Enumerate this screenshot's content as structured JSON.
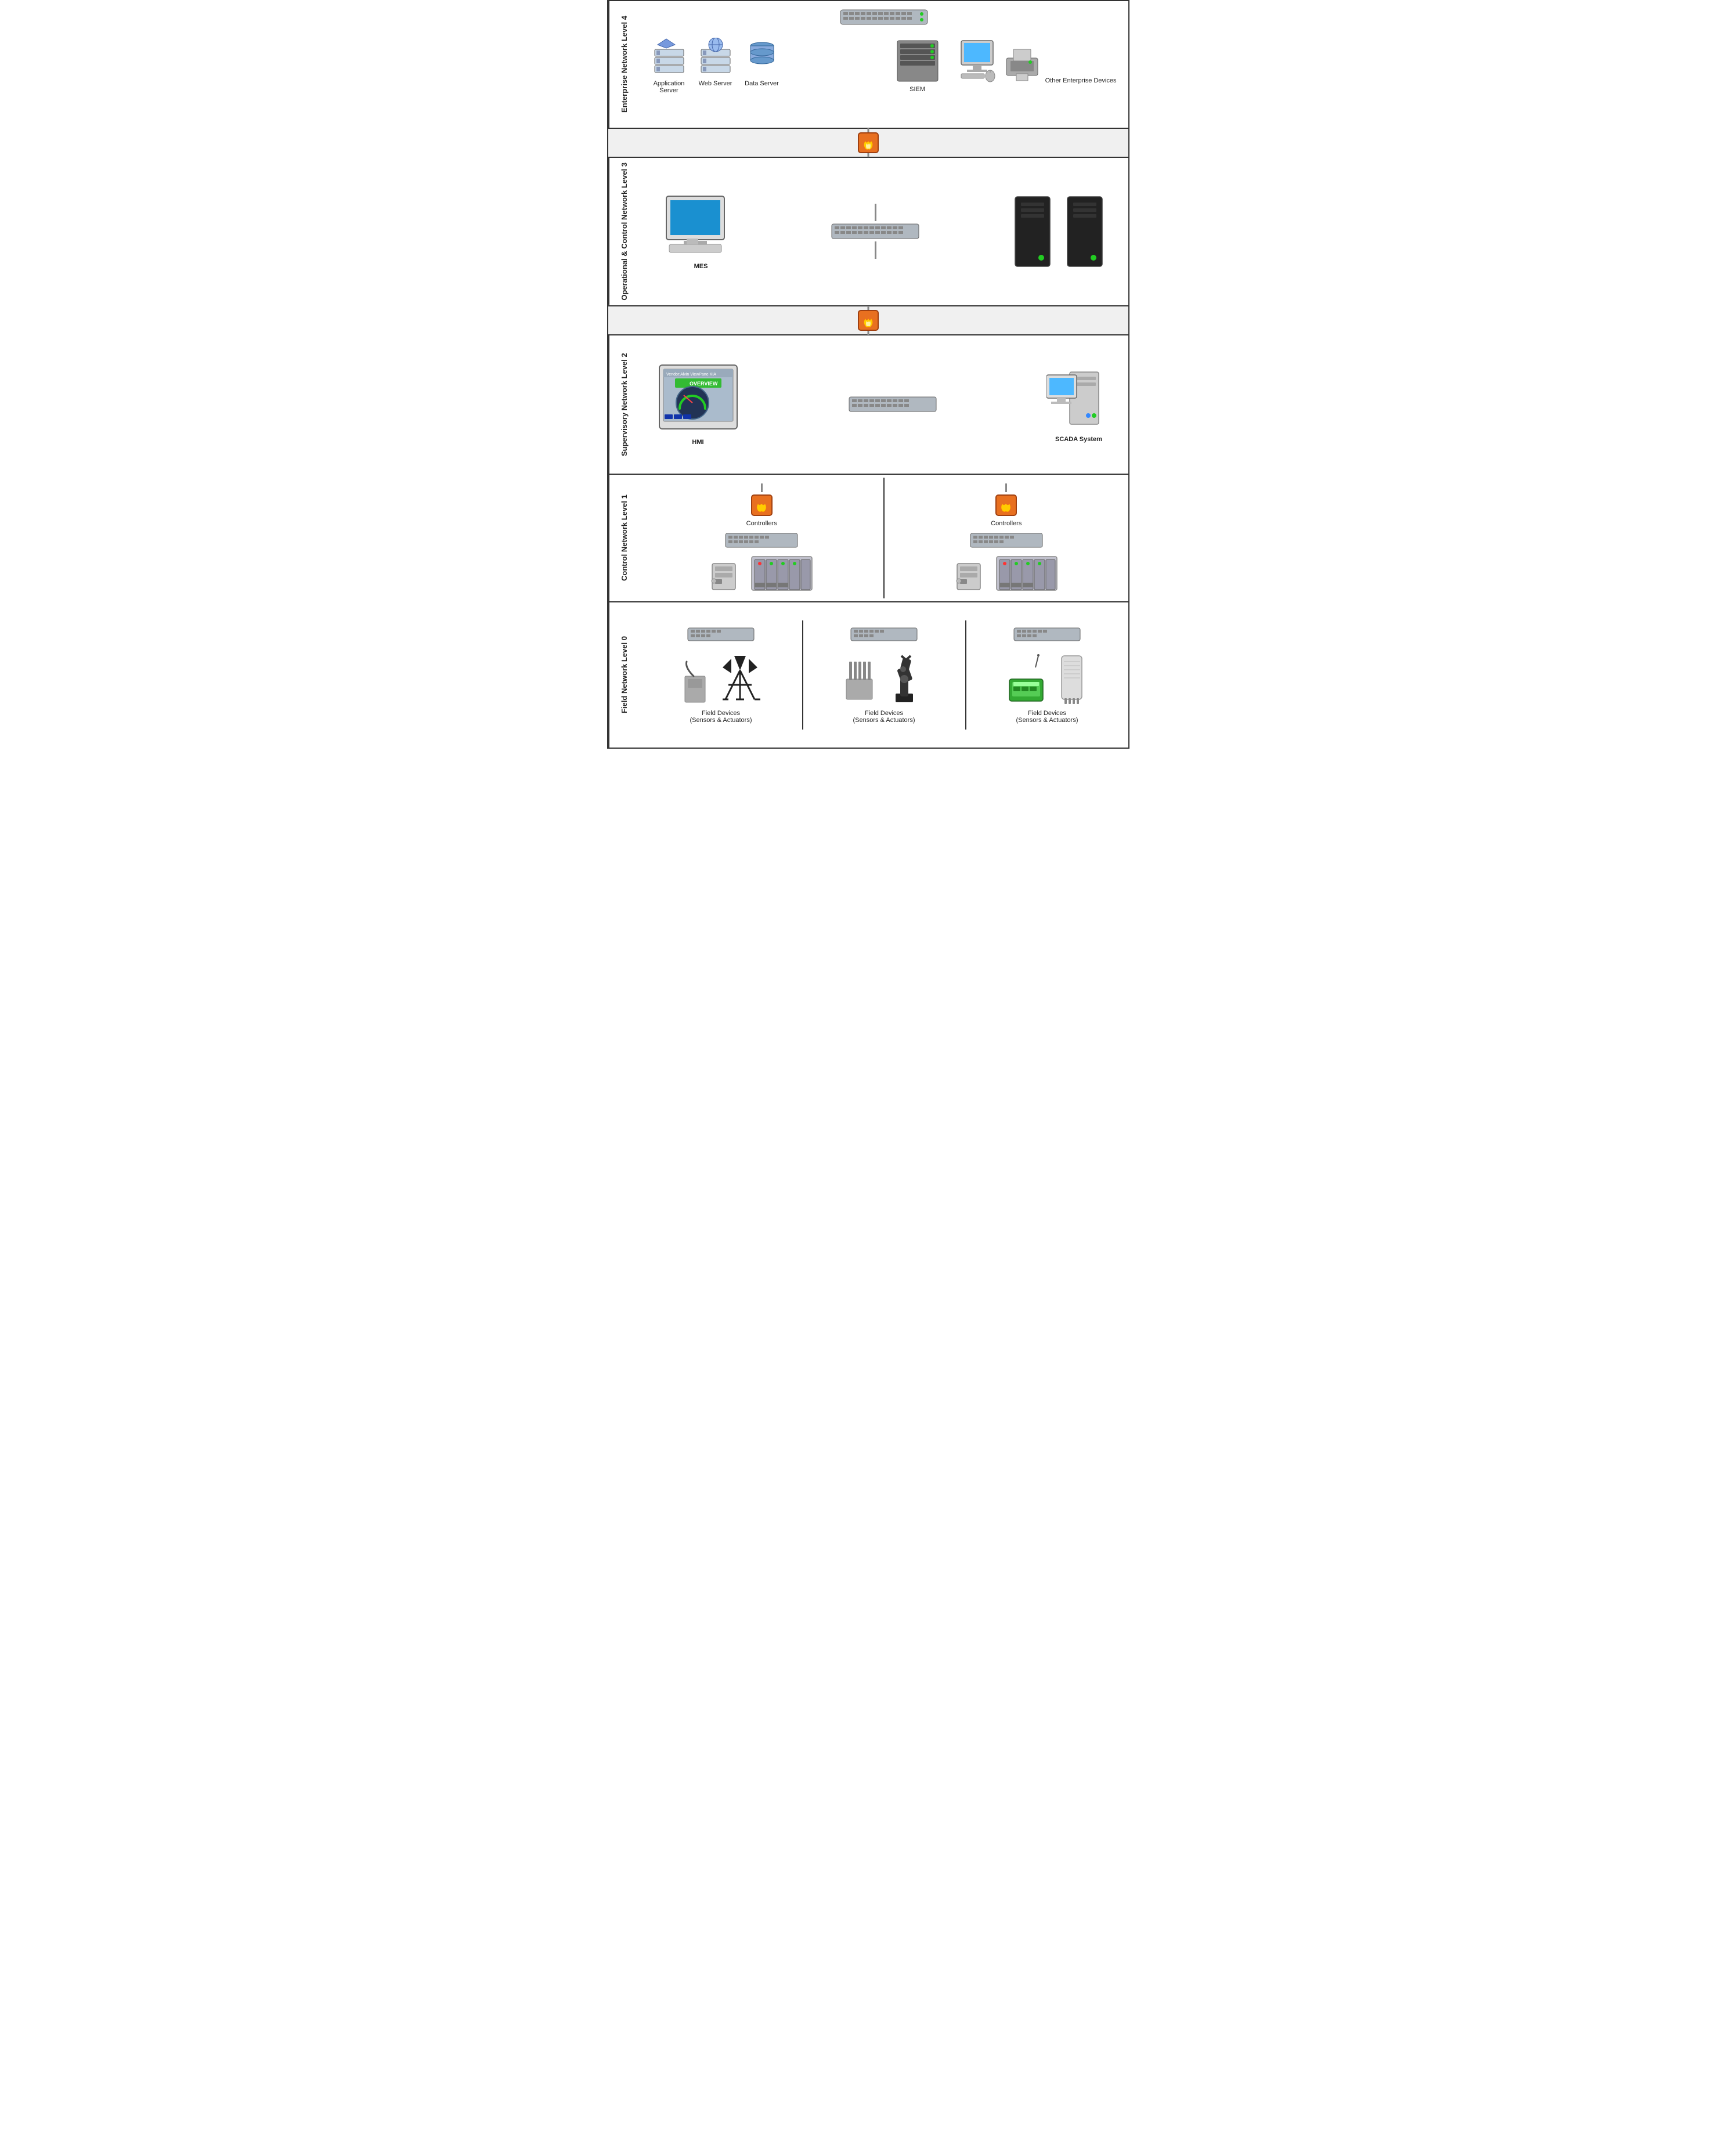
{
  "layers": [
    {
      "id": "layer4",
      "label": "Enterprise Network\nLevel 4",
      "devices": [
        {
          "name": "application-server",
          "label": "Application\nServer"
        },
        {
          "name": "web-server",
          "label": "Web Server"
        },
        {
          "name": "data-server",
          "label": "Data Server"
        },
        {
          "name": "siem",
          "label": "SIEM"
        },
        {
          "name": "other-enterprise",
          "label": "Other Enterprise Devices"
        }
      ]
    },
    {
      "id": "layer3",
      "label": "Operational & Control\nNetwork\nLevel 3",
      "devices": [
        {
          "name": "mes",
          "label": "MES"
        },
        {
          "name": "servers",
          "label": ""
        }
      ]
    },
    {
      "id": "layer2",
      "label": "Supervisory Network\nLevel 2",
      "devices": [
        {
          "name": "hmi",
          "label": "HMI"
        },
        {
          "name": "scada",
          "label": "SCADA System"
        }
      ]
    },
    {
      "id": "layer1",
      "label": "Control Network\nLevel 1",
      "devices": [
        {
          "name": "controllers-left",
          "label": "Controllers"
        },
        {
          "name": "controllers-right",
          "label": "Controllers"
        }
      ]
    },
    {
      "id": "layer0",
      "label": "Field Network\nLevel 0",
      "devices": [
        {
          "name": "field1",
          "label": "Field Devices\n(Sensors & Actuators)"
        },
        {
          "name": "field2",
          "label": "Field Devices\n(Sensors & Actuators)"
        },
        {
          "name": "field3",
          "label": "Field Devices\n(Sensors & Actuators)"
        }
      ]
    }
  ]
}
